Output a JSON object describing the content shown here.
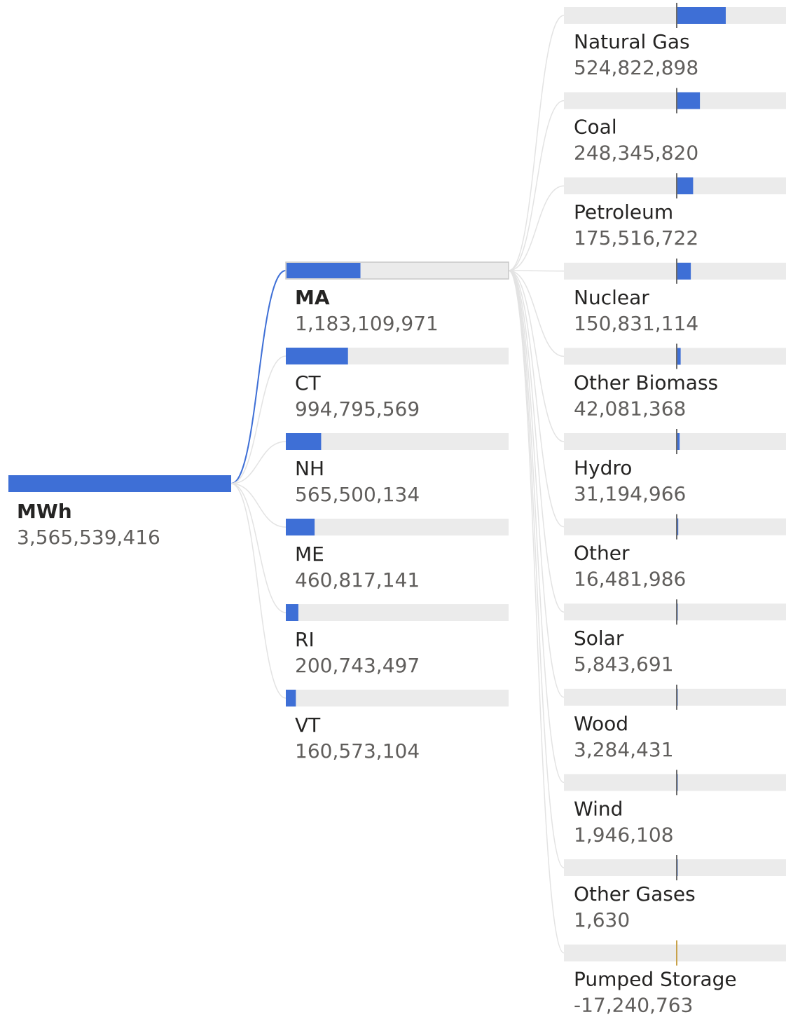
{
  "chart_data": {
    "type": "decomposition-tree",
    "root": {
      "name": "MWh",
      "value": 3565539416,
      "value_label": "3,565,539,416"
    },
    "level1": [
      {
        "name": "MA",
        "value": 1183109971,
        "value_label": "1,183,109,971",
        "expanded": true
      },
      {
        "name": "CT",
        "value": 994795569,
        "value_label": "994,795,569",
        "expanded": false
      },
      {
        "name": "NH",
        "value": 565500134,
        "value_label": "565,500,134",
        "expanded": false
      },
      {
        "name": "ME",
        "value": 460817141,
        "value_label": "460,817,141",
        "expanded": false
      },
      {
        "name": "RI",
        "value": 200743497,
        "value_label": "200,743,497",
        "expanded": false
      },
      {
        "name": "VT",
        "value": 160573104,
        "value_label": "160,573,104",
        "expanded": false
      }
    ],
    "level2": [
      {
        "name": "Natural Gas",
        "value": 524822898,
        "value_label": "524,822,898"
      },
      {
        "name": "Coal",
        "value": 248345820,
        "value_label": "248,345,820"
      },
      {
        "name": "Petroleum",
        "value": 175516722,
        "value_label": "175,516,722"
      },
      {
        "name": "Nuclear",
        "value": 150831114,
        "value_label": "150,831,114"
      },
      {
        "name": "Other Biomass",
        "value": 42081368,
        "value_label": "42,081,368"
      },
      {
        "name": "Hydro",
        "value": 31194966,
        "value_label": "31,194,966"
      },
      {
        "name": "Other",
        "value": 16481986,
        "value_label": "16,481,986"
      },
      {
        "name": "Solar",
        "value": 5843691,
        "value_label": "5,843,691"
      },
      {
        "name": "Wood",
        "value": 3284431,
        "value_label": "3,284,431"
      },
      {
        "name": "Wind",
        "value": 1946108,
        "value_label": "1,946,108"
      },
      {
        "name": "Other Gases",
        "value": 1630,
        "value_label": "1,630"
      },
      {
        "name": "Pumped Storage",
        "value": -17240763,
        "value_label": "-17,240,763"
      }
    ]
  },
  "colors": {
    "bar_fill": "#3e6fd6",
    "bar_track": "#ebebeb",
    "axis_line": "#6b6b6b",
    "negative_axis": "#c8a24a",
    "connector_active": "#3e6fd6",
    "connector_inactive": "#e3e3e3"
  }
}
